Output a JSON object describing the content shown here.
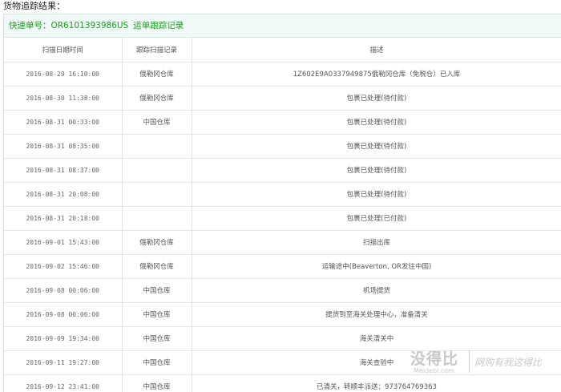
{
  "page": {
    "title": "货物追踪结果："
  },
  "tracking": {
    "number_label": "快速单号：",
    "number_value": "OR6101393986US",
    "record_link": "运单跟踪记录"
  },
  "table": {
    "headers": [
      "扫描日期时间",
      "跟踪扫描记录",
      "描述"
    ],
    "rows": [
      {
        "time": "2016-08-29 16:10:00",
        "location": "俄勒冈仓库",
        "description": "1Z602E9A0337949875俄勒冈仓库（免税仓）已入库"
      },
      {
        "time": "2016-08-30 11:38:00",
        "location": "俄勒冈仓库",
        "description": "包裹已处理(待付款)"
      },
      {
        "time": "2016-08-31 00:33:00",
        "location": "中国仓库",
        "description": "包裹已处理(待付款)"
      },
      {
        "time": "2016-08-31 08:35:00",
        "location": "",
        "description": "包裹已处理(待付款)"
      },
      {
        "time": "2016-08-31 08:37:00",
        "location": "",
        "description": "包裹已处理(待付款)"
      },
      {
        "time": "2016-08-31 20:08:00",
        "location": "",
        "description": "包裹已处理(待付款)"
      },
      {
        "time": "2016-08-31 20:18:00",
        "location": "",
        "description": "包裹已处理(已付款)"
      },
      {
        "time": "2016-09-01 15:43:00",
        "location": "俄勒冈仓库",
        "description": "扫描出库"
      },
      {
        "time": "2016-09-02 15:46:00",
        "location": "俄勒冈仓库",
        "description": "运输途中(Beaverton, OR发往中国)"
      },
      {
        "time": "2016-09-08 00:06:00",
        "location": "中国仓库",
        "description": "机场提货"
      },
      {
        "time": "2016-09-08 00:06:00",
        "location": "中国仓库",
        "description": "提货到至海关处理中心，准备清关"
      },
      {
        "time": "2016-09-09 19:34:00",
        "location": "中国仓库",
        "description": "海关清关中"
      },
      {
        "time": "2016-09-11 19:27:00",
        "location": "中国仓库",
        "description": "海关查验中"
      },
      {
        "time": "2016-09-12 23:41:00",
        "location": "中国仓库",
        "description": "已清关，转顺丰派送：973764769363"
      }
    ]
  },
  "watermark": {
    "logo": "没得比",
    "domain": "Meidebi.com",
    "slogan": "网购有我这得比"
  },
  "colors": {
    "header_green": "#1a9d1a",
    "header_bg": "#f0f8f8",
    "border": "#e3e3e3"
  }
}
